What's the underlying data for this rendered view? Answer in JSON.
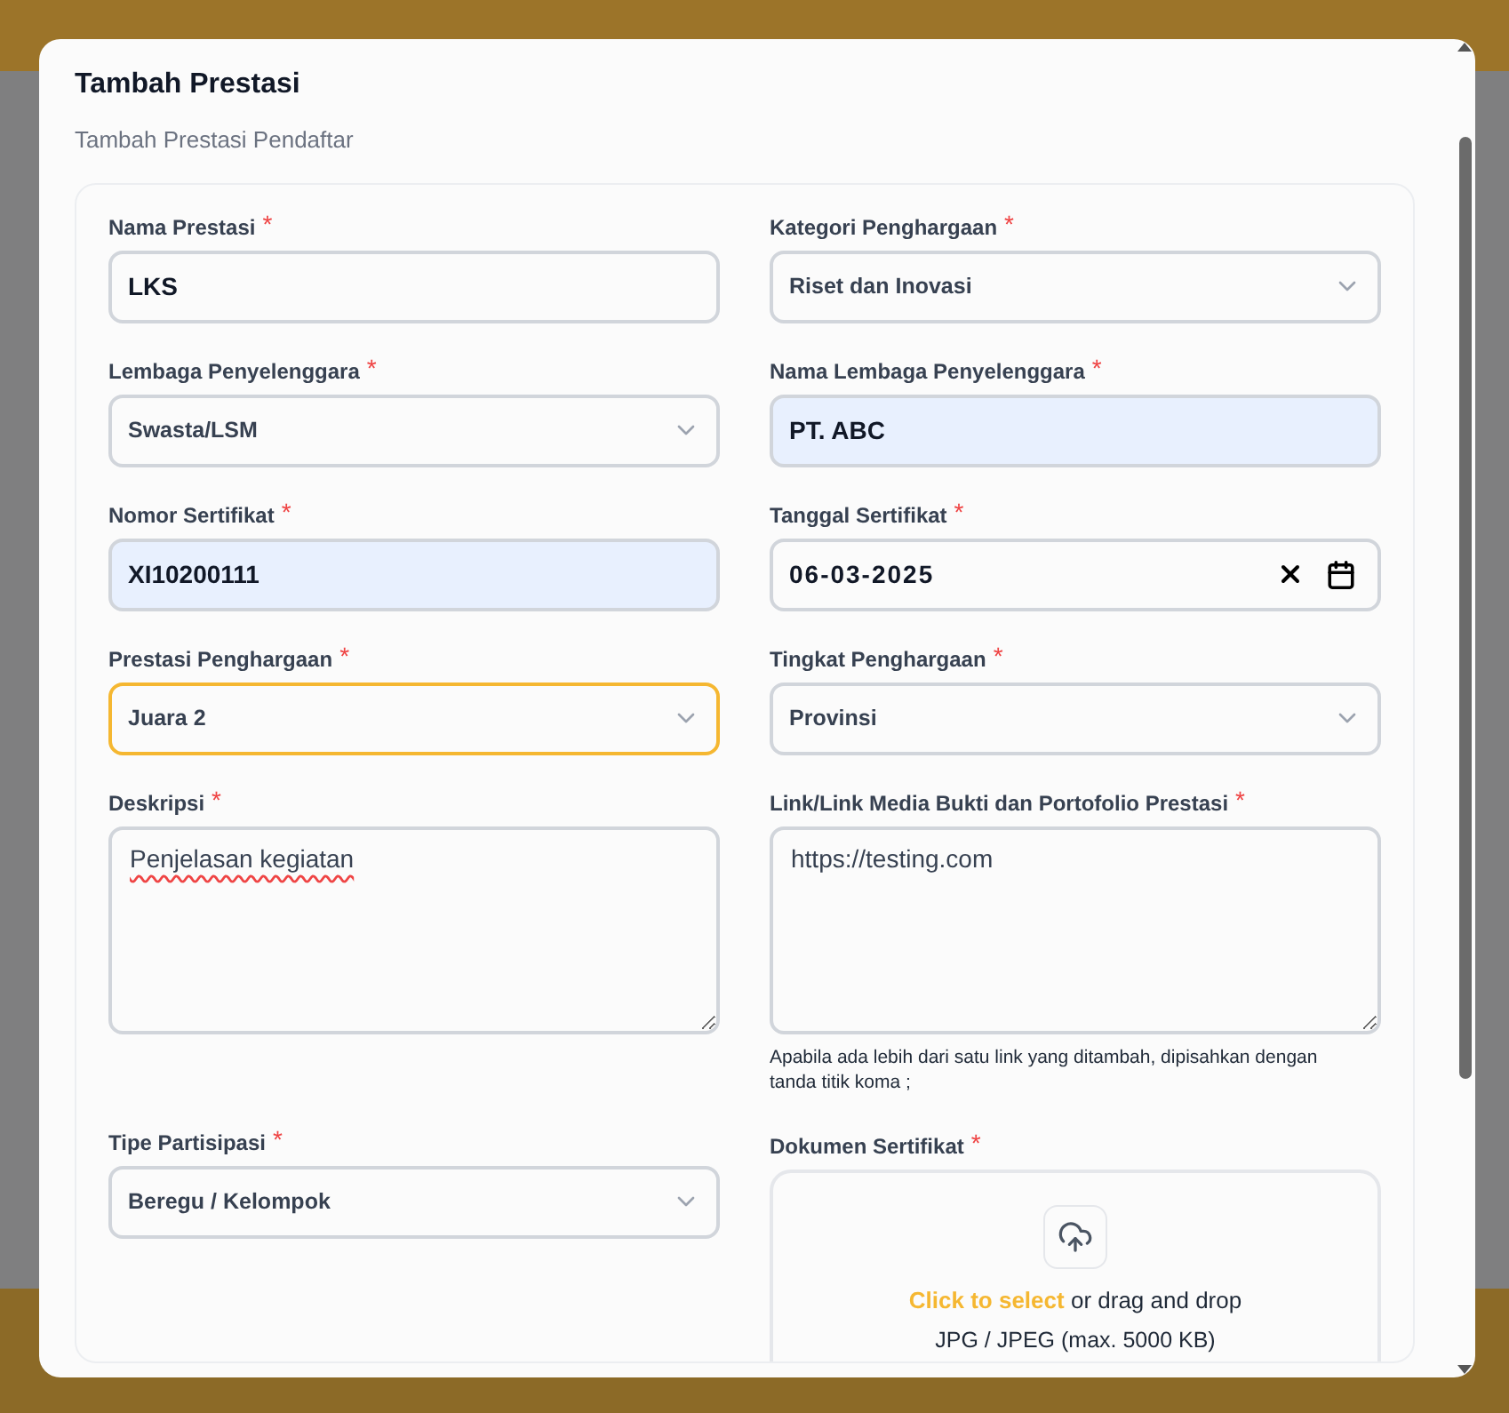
{
  "dialog": {
    "title": "Tambah Prestasi",
    "subtitle": "Tambah Prestasi Pendaftar"
  },
  "fields": [
    {
      "kind": "text",
      "label": "Nama Prestasi",
      "required_mark": "*",
      "value": "LKS",
      "autofilled": false,
      "focused": false
    },
    {
      "kind": "select",
      "label": "Kategori Penghargaan",
      "required_mark": "*",
      "value": "Riset dan Inovasi",
      "focused": false
    },
    {
      "kind": "select",
      "label": "Lembaga Penyelenggara",
      "required_mark": "*",
      "value": "Swasta/LSM",
      "focused": false
    },
    {
      "kind": "text",
      "label": "Nama Lembaga Penyelenggara",
      "required_mark": "*",
      "value": "PT. ABC",
      "autofilled": true,
      "focused": false
    },
    {
      "kind": "text",
      "label": "Nomor Sertifikat",
      "required_mark": "*",
      "value": "XI10200111",
      "autofilled": true,
      "focused": false
    },
    {
      "kind": "date",
      "label": "Tanggal Sertifikat",
      "required_mark": "*",
      "value": "06-03-2025",
      "focused": false
    },
    {
      "kind": "select",
      "label": "Prestasi Penghargaan",
      "required_mark": "*",
      "value": "Juara 2",
      "focused": true
    },
    {
      "kind": "select",
      "label": "Tingkat Penghargaan",
      "required_mark": "*",
      "value": "Provinsi",
      "focused": false
    },
    {
      "kind": "textarea",
      "label": "Deskripsi",
      "required_mark": "*",
      "value": "Penjelasan kegiatan",
      "spellcheck_error": true
    },
    {
      "kind": "textarea",
      "label": "Link/Link Media Bukti dan Portofolio Prestasi",
      "required_mark": "*",
      "value": "https://testing.com",
      "spellcheck_error": false,
      "hint": "Apabila ada lebih dari satu link yang ditambah, dipisahkan dengan tanda titik koma ;"
    },
    {
      "kind": "select",
      "label": "Tipe Partisipasi",
      "required_mark": "*",
      "value": "Beregu / Kelompok",
      "focused": false
    },
    {
      "kind": "upload",
      "label": "Dokumen Sertifikat",
      "required_mark": "*",
      "link": "Click to select",
      "text": "or drag and drop",
      "formats": "JPG / JPEG (max. 5000 KB)"
    }
  ]
}
